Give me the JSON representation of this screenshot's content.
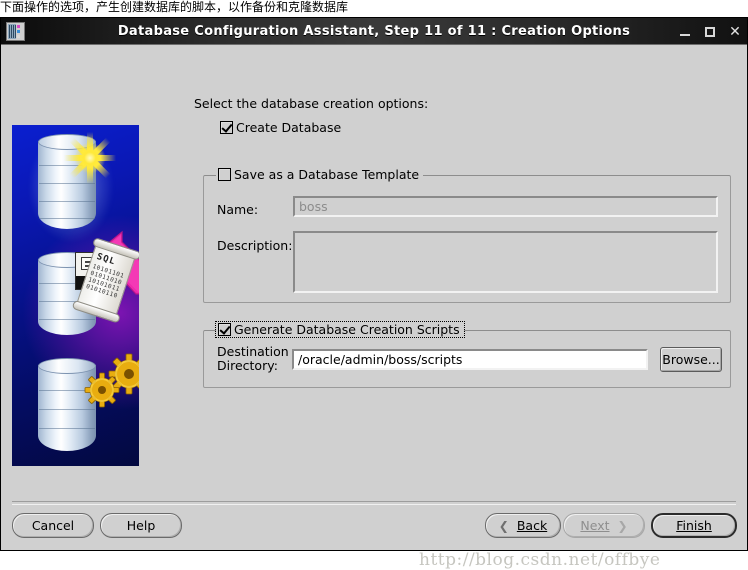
{
  "page_top_note": "下面操作的选项，产生创建数据库的脚本，以作备份和克隆数据库",
  "window": {
    "title": "Database Configuration Assistant, Step 11 of 11 : Creation Options",
    "minimize_label": "Minimize",
    "maximize_label": "Maximize",
    "close_label": "Close",
    "app_icon": "database-app-icon"
  },
  "sidebar": {
    "art_name": "database-creation-illustration",
    "scroll_label": "SQL",
    "scroll_bits": "10101101010110101010101101010110"
  },
  "main": {
    "intro": "Select the database creation options:",
    "create_database": {
      "label": "Create Database",
      "checked": true
    },
    "template_group": {
      "title": "Save as a Database Template",
      "checked": false,
      "enabled": false,
      "name_label": "Name:",
      "name_value": "boss",
      "description_label": "Description:",
      "description_value": ""
    },
    "scripts_group": {
      "title": "Generate Database Creation Scripts",
      "checked": true,
      "focused": true,
      "destination_label_line1": "Destination",
      "destination_label_line2": "Directory:",
      "destination_value": "/oracle/admin/boss/scripts",
      "browse_label": "Browse..."
    }
  },
  "footer": {
    "cancel_label": "Cancel",
    "help_label": "Help",
    "back_label": "Back",
    "back_icon": "chevron-left-icon",
    "next_label": "Next",
    "next_icon": "chevron-right-icon",
    "next_disabled": true,
    "finish_label": "Finish",
    "finish_default": true
  },
  "watermark": "http://blog.csdn.net/offbye",
  "colors": {
    "face": "#d0d0d0",
    "titlebar_dark": "#1a1a1a",
    "accent_blue": "#0a18b4",
    "arrow_pink": "#ee2aad",
    "star_yellow": "#ffe93a",
    "gear_gold": "#f0b515"
  }
}
